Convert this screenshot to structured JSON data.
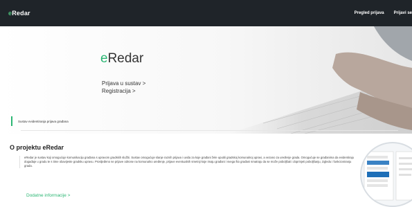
{
  "header": {
    "brand_prefix": "e",
    "brand_rest": "Redar",
    "nav": [
      {
        "label": "Pregled prijava"
      },
      {
        "label": "Prijavi se"
      }
    ]
  },
  "hero": {
    "title_prefix": "e",
    "title_rest": "Redar",
    "links": [
      {
        "label": "Prijava u sustav >"
      },
      {
        "label": "Registracija >"
      }
    ],
    "notice": "Sustav evidentiranja prijava građana",
    "background": "keyboard-typing-hands-photo"
  },
  "about": {
    "title": "O projektu eRedar",
    "description": "eRedar je sustav koji omogućuje komunikaciju građana s upravom gradskih službi. Sustav omogućuje slanje raznih prijava i uvida za koje građani žele uputiti gradskoj komunalnoj upravi, a vezano za uređenje grada. Omogućuje se građanima da evidentiraju događaje u gradu te s time obavijeste gradsku upravu. Prosljeđeno se prijave odnose na komunalno uređenje, prijave eventualnih smetnji koje imaju građani i svega što građani smatraju da se može poboljšati i doprinjeti poboljšanju, izgledu i funkcioniranju grada.",
    "more_link": "Dodatne informacije >"
  },
  "colors": {
    "accent": "#2bb673",
    "topbar": "#1f2429"
  }
}
